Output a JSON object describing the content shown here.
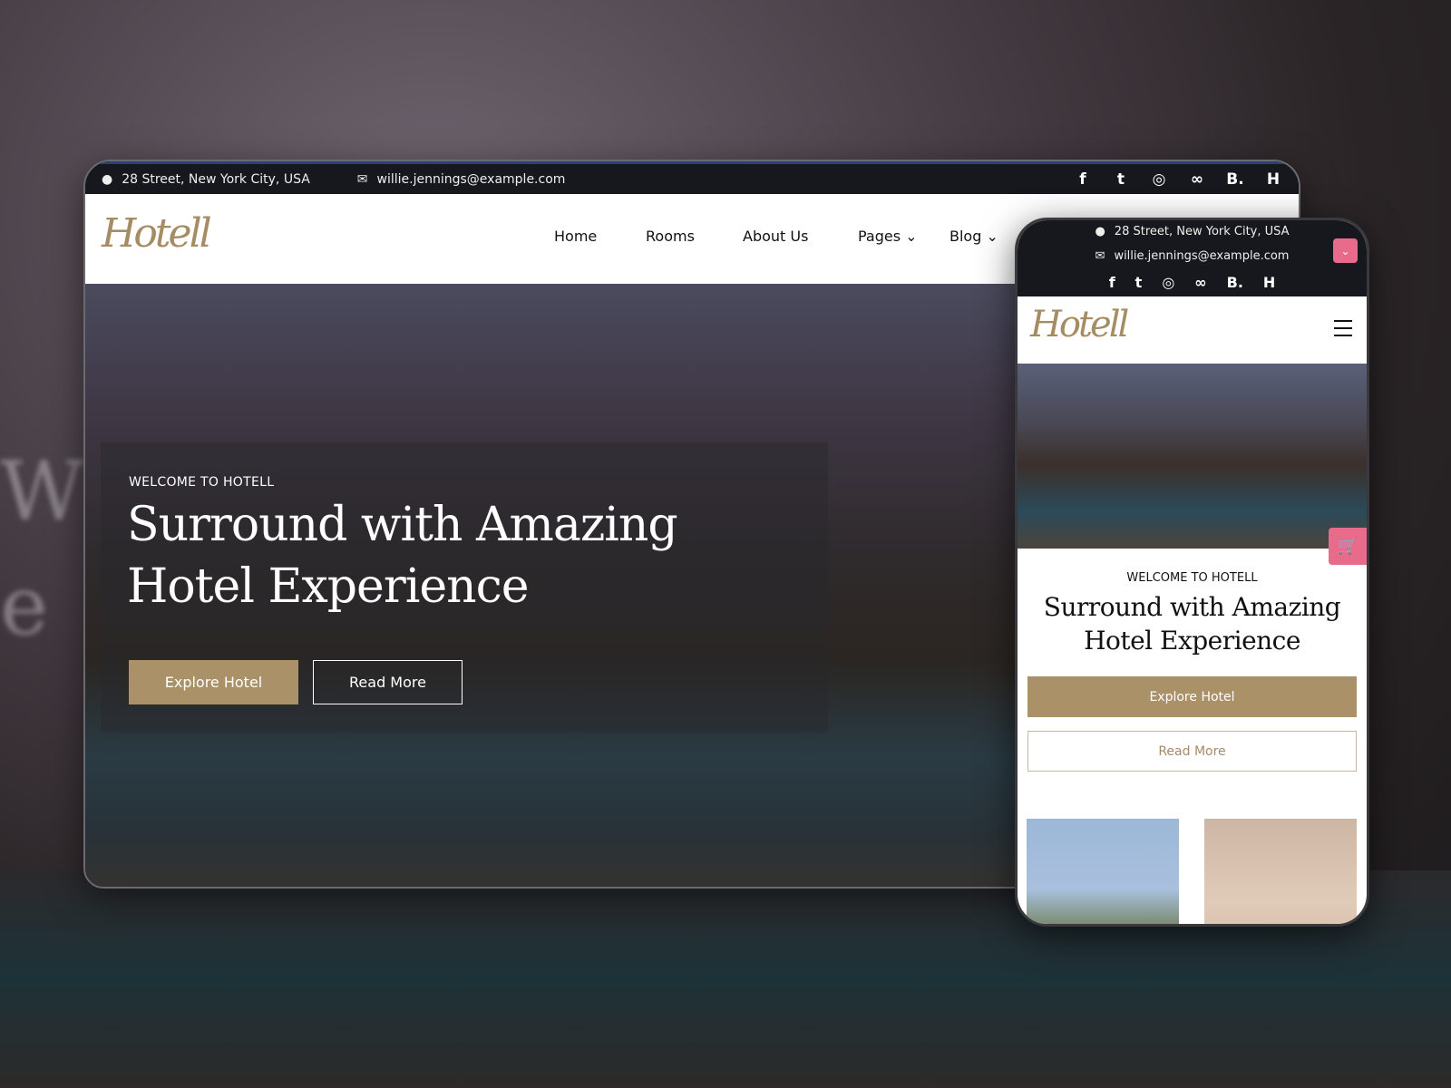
{
  "topbar": {
    "address": "28 Street, New York City, USA",
    "email": "willie.jennings@example.com",
    "social": [
      {
        "icon": "facebook-icon",
        "glyph": "f"
      },
      {
        "icon": "twitter-icon",
        "glyph": "t"
      },
      {
        "icon": "instagram-icon",
        "glyph": "◎"
      },
      {
        "icon": "tripadvisor-icon",
        "glyph": "∞"
      },
      {
        "icon": "booking-icon",
        "glyph": "B."
      },
      {
        "icon": "hotels-icon",
        "glyph": "H"
      }
    ]
  },
  "brand": {
    "logo": "Hotell",
    "accent": "#ab9168",
    "pink": "#e86b8c"
  },
  "nav": {
    "items": [
      "Home",
      "Rooms",
      "About Us",
      "Pages",
      "Blog"
    ],
    "caret": "⌄"
  },
  "hero": {
    "eyebrow": "WELCOME TO HOTELL",
    "title_line1": "Surround with Amazing",
    "title_line2": "Hotel Experience",
    "primary": "Explore Hotel",
    "secondary": "Read More"
  },
  "mobile": {
    "toggle_glyph": "⌄",
    "cart_glyph": "🛒"
  }
}
